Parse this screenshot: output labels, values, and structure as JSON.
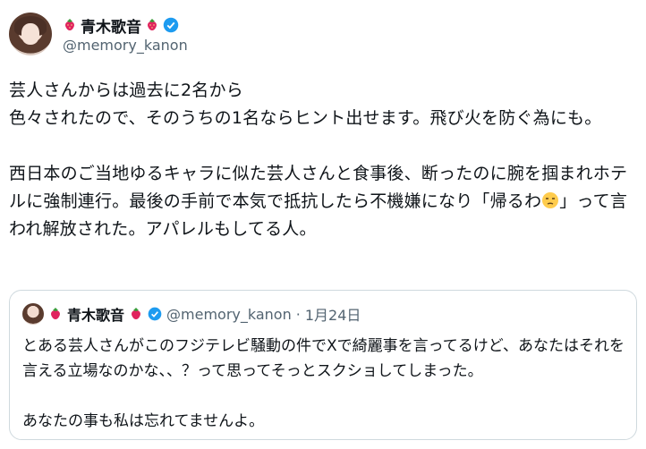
{
  "author": {
    "name": "青木歌音",
    "handle": "@memory_kanon"
  },
  "post": {
    "text": "芸人さんからは過去に2名から\n色々されたので、そのうちの1名ならヒント出せます。飛び火を防ぐ為にも。\n\n西日本のご当地ゆるキャラに似た芸人さんと食事後、断ったのに腕を掴まれホテルに強制連行。最後の手前で本気で抵抗したら不機嫌になり「帰るわ",
    "text_after_emoji": "」って言われ解放された。アパレルもしてる人。",
    "emoji": "unamused-face-icon"
  },
  "quoted": {
    "name": "青木歌音",
    "handle": "@memory_kanon",
    "separator": "·",
    "date": "1月24日",
    "text": "とある芸人さんがこのフジテレビ騒動の件でXで綺麗事を言ってるけど、あなたはそれを言える立場なのかな、、？って思ってそっとスクショしてしまった。\n\nあなたの事も私は忘れてませんよ。"
  },
  "colors": {
    "verified": "#1d9bf0",
    "strawberry": "#e0245e",
    "secondary_text": "#536471"
  }
}
